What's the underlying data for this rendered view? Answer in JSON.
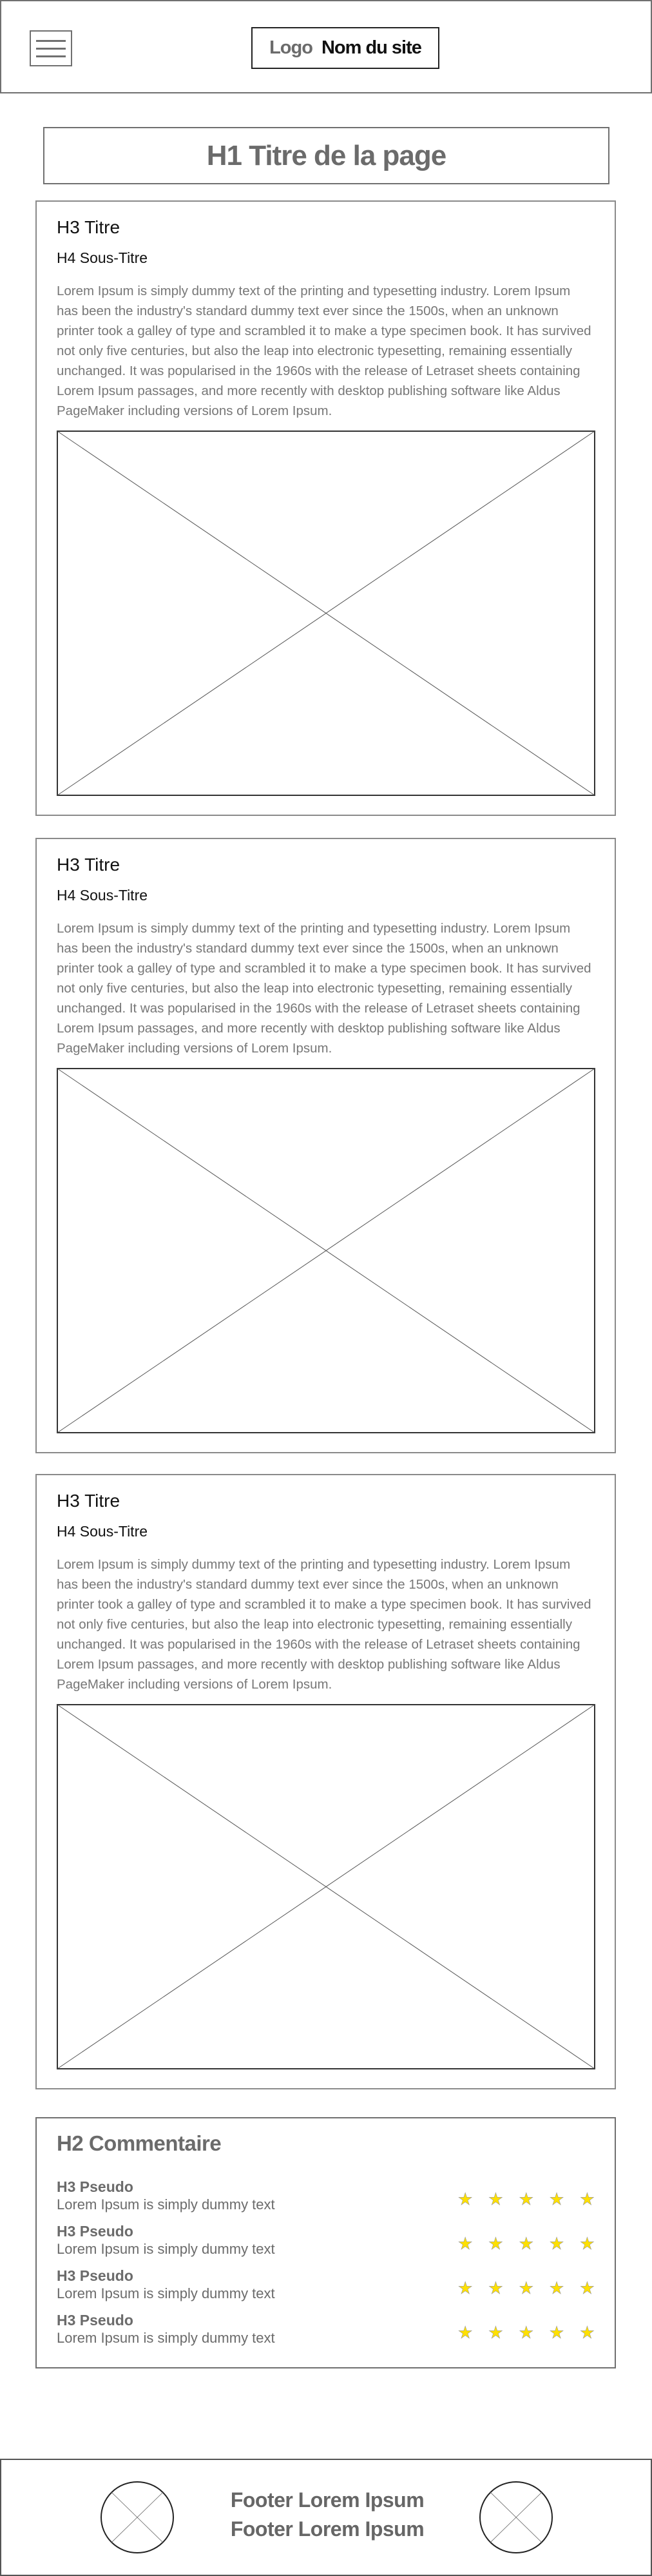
{
  "header": {
    "logo": "Logo",
    "site_name": "Nom du site"
  },
  "page_title": "H1 Titre de la page",
  "cards": [
    {
      "title": "H3 Titre",
      "subtitle": "H4 Sous-Titre",
      "body": "Lorem Ipsum is simply dummy text of the printing and typesetting industry. Lorem Ipsum has been the industry's standard dummy text ever since the 1500s, when an unknown printer took a galley of type and scrambled it to make a type specimen book. It has survived not only five centuries, but also the leap into electronic typesetting, remaining essentially unchanged. It was popularised in the 1960s with the release of Letraset sheets containing Lorem Ipsum passages, and more recently with desktop publishing software like Aldus PageMaker including versions of Lorem Ipsum."
    },
    {
      "title": "H3 Titre",
      "subtitle": "H4 Sous-Titre",
      "body": "Lorem Ipsum is simply dummy text of the printing and typesetting industry. Lorem Ipsum has been the industry's standard dummy text ever since the 1500s, when an unknown printer took a galley of type and scrambled it to make a type specimen book. It has survived not only five centuries, but also the leap into electronic typesetting, remaining essentially unchanged. It was popularised in the 1960s with the release of Letraset sheets containing Lorem Ipsum passages, and more recently with desktop publishing software like Aldus PageMaker including versions of Lorem Ipsum."
    },
    {
      "title": "H3 Titre",
      "subtitle": "H4 Sous-Titre",
      "body": "Lorem Ipsum is simply dummy text of the printing and typesetting industry. Lorem Ipsum has been the industry's standard dummy text ever since the 1500s, when an unknown printer took a galley of type and scrambled it to make a type specimen book. It has survived not only five centuries, but also the leap into electronic typesetting, remaining essentially unchanged. It was popularised in the 1960s with the release of Letraset sheets containing Lorem Ipsum passages, and more recently with desktop publishing software like Aldus PageMaker including versions of Lorem Ipsum."
    }
  ],
  "comments": {
    "title": "H2 Commentaire",
    "star_color": "#ffe000",
    "items": [
      {
        "author": "H3 Pseudo",
        "text": "Lorem Ipsum is simply dummy text",
        "rating": 5
      },
      {
        "author": "H3 Pseudo",
        "text": "Lorem Ipsum is simply dummy text",
        "rating": 5
      },
      {
        "author": "H3 Pseudo",
        "text": "Lorem Ipsum is simply dummy text",
        "rating": 5
      },
      {
        "author": "H3 Pseudo",
        "text": "Lorem Ipsum is simply dummy text",
        "rating": 5
      }
    ]
  },
  "footer": {
    "line1": "Footer Lorem Ipsum",
    "line2": "Footer Lorem Ipsum"
  }
}
